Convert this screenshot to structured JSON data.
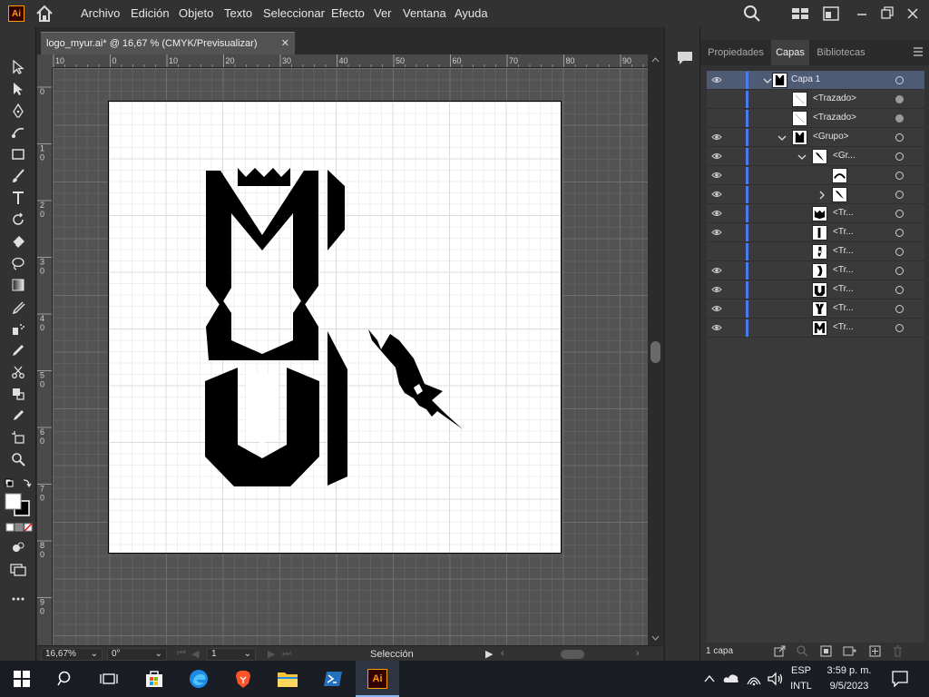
{
  "app": {
    "logo_text": "Ai"
  },
  "menu": [
    "Archivo",
    "Edición",
    "Objeto",
    "Texto",
    "Seleccionar",
    "Efecto",
    "Ver",
    "Ventana",
    "Ayuda"
  ],
  "document": {
    "tab_label": "logo_myur.ai* @ 16,67 % (CMYK/Previsualizar)",
    "close_glyph": "✕"
  },
  "rulers": {
    "top": [
      "10",
      "0",
      "10",
      "20",
      "30",
      "40",
      "50",
      "60",
      "70",
      "80",
      "90"
    ],
    "left": [
      "0",
      "1 0",
      "2 0",
      "3 0",
      "4 0",
      "5 0",
      "6 0",
      "7 0",
      "8 0",
      "9 0"
    ]
  },
  "status": {
    "zoom": "16,67%",
    "rotation": "0°",
    "artboard": "1",
    "tool_name": "Selección"
  },
  "panel": {
    "tabs": [
      "Propiedades",
      "Capas",
      "Bibliotecas"
    ],
    "active_tab": "Capas",
    "layer_count": "1 capa",
    "layers": [
      {
        "label": "Capa 1",
        "visible": true,
        "expanded": true,
        "level": 0,
        "selected": true,
        "target_filled": false,
        "thumb": "logo"
      },
      {
        "label": "<Trazado>",
        "visible": false,
        "expanded": null,
        "level": 1,
        "selected": false,
        "target_filled": true,
        "thumb": "line"
      },
      {
        "label": "<Trazado>",
        "visible": false,
        "expanded": null,
        "level": 1,
        "selected": false,
        "target_filled": true,
        "thumb": "line"
      },
      {
        "label": "<Grupo>",
        "visible": true,
        "expanded": true,
        "level": 1,
        "selected": false,
        "target_filled": false,
        "thumb": "logo"
      },
      {
        "label": "<Gr...",
        "visible": true,
        "expanded": true,
        "level": 2,
        "selected": false,
        "target_filled": false,
        "thumb": "dagger"
      },
      {
        "label": "",
        "visible": true,
        "expanded": null,
        "level": 3,
        "selected": false,
        "target_filled": false,
        "thumb": "arc"
      },
      {
        "label": "",
        "visible": true,
        "expanded": false,
        "level": 3,
        "selected": false,
        "target_filled": false,
        "thumb": "dagger"
      },
      {
        "label": "<Tr...",
        "visible": true,
        "expanded": null,
        "level": 2,
        "selected": false,
        "target_filled": false,
        "thumb": "crown"
      },
      {
        "label": "<Tr...",
        "visible": true,
        "expanded": null,
        "level": 2,
        "selected": false,
        "target_filled": false,
        "thumb": "bar"
      },
      {
        "label": "<Tr...",
        "visible": false,
        "expanded": null,
        "level": 2,
        "selected": false,
        "target_filled": false,
        "thumb": "hook"
      },
      {
        "label": "<Tr...",
        "visible": true,
        "expanded": null,
        "level": 2,
        "selected": false,
        "target_filled": false,
        "thumb": "curve"
      },
      {
        "label": "<Tr...",
        "visible": true,
        "expanded": null,
        "level": 2,
        "selected": false,
        "target_filled": false,
        "thumb": "u"
      },
      {
        "label": "<Tr...",
        "visible": true,
        "expanded": null,
        "level": 2,
        "selected": false,
        "target_filled": false,
        "thumb": "y"
      },
      {
        "label": "<Tr...",
        "visible": true,
        "expanded": null,
        "level": 2,
        "selected": false,
        "target_filled": false,
        "thumb": "m"
      }
    ]
  },
  "taskbar": {
    "language": "ESP",
    "layout": "INTL",
    "time": "3:59 p. m.",
    "date": "9/5/2023",
    "ai_label": "Ai"
  }
}
